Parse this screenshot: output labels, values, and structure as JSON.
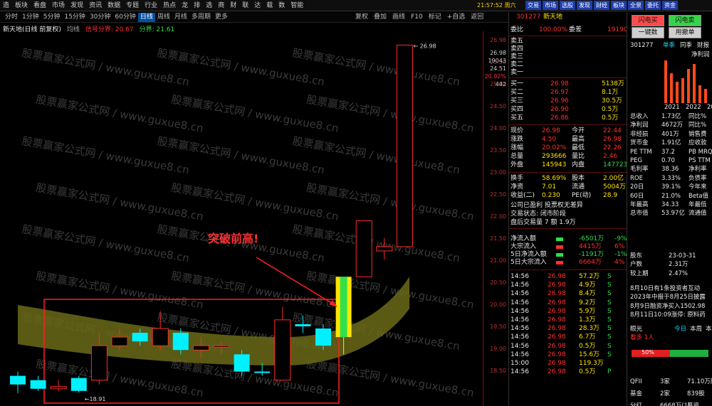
{
  "menu": [
    "造",
    "板块",
    "看盘",
    "市场",
    "发现",
    "资讯",
    "数据",
    "专题",
    "行业",
    "热点",
    "龙",
    "排",
    "选",
    "商",
    "财",
    "联",
    "达",
    "载",
    "数",
    "智能"
  ],
  "clock": "21:57:52 周六",
  "top_buttons": [
    "交易",
    "市场",
    "选股",
    "发现",
    "财经",
    "板块",
    "全景",
    "委托",
    "资金"
  ],
  "periods": [
    "分时",
    "1分钟",
    "5分钟",
    "15分钟",
    "30分钟",
    "60分钟",
    "日线",
    "周线",
    "月线",
    "多周期",
    "更多"
  ],
  "active_period": "日线",
  "tools": [
    "复权",
    "叠加",
    "画线",
    "F10",
    "标记",
    "+自选",
    "返回"
  ],
  "chart_title": {
    "name": "新天地(日线 前复权)",
    "ma": "均线",
    "indicator": "信号分界: 20.67",
    "indicator2": "分界: 21.61"
  },
  "annotation": "突破前高!",
  "watermark": "股票赢家公式网  /  www.guxue8.cn",
  "y_ticks": [
    "26.98",
    "25.50",
    "25.00",
    "24.50",
    "24.00",
    "23.50",
    "23.00",
    "22.50",
    "22.00",
    "21.50",
    "21.00",
    "20.50",
    "20.00",
    "19.50",
    "19.00",
    "18.50"
  ],
  "y_side_values": [
    "26.98",
    "19043",
    "24.51",
    "20.02%",
    "442"
  ],
  "chart_data": {
    "type": "candlestick",
    "last_price": "26.98",
    "low_label": "18.91",
    "candles": [
      {
        "o": 19.1,
        "c": 19.3,
        "h": 19.4,
        "l": 18.9,
        "color": "cyan"
      },
      {
        "o": 19.2,
        "c": 19.0,
        "h": 19.3,
        "l": 18.95,
        "color": "cyan"
      },
      {
        "o": 19.0,
        "c": 19.05,
        "h": 19.2,
        "l": 18.95,
        "color": "red"
      },
      {
        "o": 19.25,
        "c": 18.95,
        "h": 19.3,
        "l": 18.91,
        "color": "cyan"
      },
      {
        "o": 19.2,
        "c": 20.0,
        "h": 20.3,
        "l": 19.1,
        "color": "red"
      },
      {
        "o": 20.0,
        "c": 20.2,
        "h": 20.4,
        "l": 19.9,
        "color": "red"
      },
      {
        "o": 20.3,
        "c": 20.1,
        "h": 20.4,
        "l": 20.0,
        "color": "cyan"
      },
      {
        "o": 20.0,
        "c": 20.4,
        "h": 20.8,
        "l": 19.9,
        "color": "red"
      },
      {
        "o": 20.3,
        "c": 19.9,
        "h": 20.4,
        "l": 19.8,
        "color": "cyan"
      },
      {
        "o": 20.0,
        "c": 19.9,
        "h": 20.2,
        "l": 19.7,
        "color": "red"
      },
      {
        "o": 20.0,
        "c": 20.0,
        "h": 20.1,
        "l": 19.8,
        "color": "red"
      },
      {
        "o": 19.8,
        "c": 19.4,
        "h": 19.9,
        "l": 19.3,
        "color": "cyan"
      },
      {
        "o": 19.4,
        "c": 19.4,
        "h": 19.6,
        "l": 19.3,
        "color": "cyan"
      },
      {
        "o": 19.2,
        "c": 20.6,
        "h": 20.9,
        "l": 19.2,
        "color": "red"
      },
      {
        "o": 20.5,
        "c": 20.45,
        "h": 20.7,
        "l": 20.3,
        "color": "cyan"
      },
      {
        "o": 20.4,
        "c": 20.0,
        "h": 20.5,
        "l": 19.9,
        "color": "cyan"
      },
      {
        "o": 20.2,
        "c": 21.6,
        "h": 21.6,
        "l": 19.8,
        "color": "yellow"
      },
      {
        "o": 21.6,
        "c": 22.9,
        "h": 22.9,
        "l": 21.6,
        "color": "red"
      },
      {
        "o": 22.3,
        "c": 22.2,
        "h": 22.5,
        "l": 22.0,
        "color": "red"
      },
      {
        "o": 22.3,
        "c": 26.98,
        "h": 26.98,
        "l": 22.3,
        "color": "red"
      }
    ]
  },
  "quote": {
    "code": "301277",
    "name": "新天地",
    "weibi_label": "委比",
    "weibi": "100.00%",
    "weicha_label": "委差",
    "weicha": "19190",
    "sell_labels": [
      "卖五",
      "卖四",
      "卖三",
      "卖二",
      "卖一"
    ],
    "buys": [
      {
        "label": "买一",
        "price": "26.98",
        "vol": "5138万"
      },
      {
        "label": "买二",
        "price": "26.97",
        "vol": "8.1万"
      },
      {
        "label": "买三",
        "price": "26.96",
        "vol": "30.5万"
      },
      {
        "label": "买四",
        "price": "26.90",
        "vol": "0.5万"
      },
      {
        "label": "买五",
        "price": "26.86",
        "vol": "0.5万"
      }
    ],
    "stats": [
      {
        "l1": "现价",
        "v1": "26.98",
        "l2": "今开",
        "v2": "22.44"
      },
      {
        "l1": "涨跌",
        "v1": "4.50",
        "l2": "最高",
        "v2": "26.98"
      },
      {
        "l1": "涨幅",
        "v1": "20.02%",
        "l2": "最低",
        "v2": "22.26"
      },
      {
        "l1": "总量",
        "v1": "293666",
        "l2": "量比",
        "v2": "2.46"
      },
      {
        "l1": "外盘",
        "v1": "145943",
        "l2": "内盘",
        "v2": "147723"
      }
    ],
    "stats2": [
      {
        "l1": "换手",
        "v1": "58.69%",
        "l2": "股本",
        "v2": "2.00亿"
      },
      {
        "l1": "净资",
        "v1": "7.01",
        "l2": "流通",
        "v2": "5004万"
      },
      {
        "l1": "收益(二)",
        "v1": "0.230",
        "l2": "PE(动)",
        "v2": "28.9"
      }
    ],
    "notes": [
      "公司已盈利 投票权无差异",
      "交易状态: 闭市阶段",
      "盘后交易量 7 额 1.9万"
    ],
    "flows": [
      {
        "label": "净流入额",
        "value": "-6501万",
        "pct": "-9%"
      },
      {
        "label": "大宗流入",
        "value": "4415万",
        "pct": "6%"
      },
      {
        "label": "5日净流入额",
        "value": "-1191万",
        "pct": "-1%"
      },
      {
        "label": "5日大宗流入",
        "value": "6664万",
        "pct": "4%"
      }
    ],
    "ticks": [
      {
        "t": "14:56",
        "p": "26.98",
        "v": "57.2万",
        "d": "S"
      },
      {
        "t": "14:56",
        "p": "26.98",
        "v": "4.9万",
        "d": "S"
      },
      {
        "t": "14:56",
        "p": "26.98",
        "v": "8.4万",
        "d": "S"
      },
      {
        "t": "14:56",
        "p": "26.98",
        "v": "9.2万",
        "d": "S"
      },
      {
        "t": "14:56",
        "p": "26.98",
        "v": "5.9万",
        "d": "S"
      },
      {
        "t": "14:56",
        "p": "26.98",
        "v": "1.3万",
        "d": "S"
      },
      {
        "t": "14:56",
        "p": "26.98",
        "v": "28.3万",
        "d": "S"
      },
      {
        "t": "14:56",
        "p": "26.98",
        "v": "6.7万",
        "d": "S"
      },
      {
        "t": "14:56",
        "p": "26.98",
        "v": "0.5万",
        "d": "S"
      },
      {
        "t": "14:56",
        "p": "26.98",
        "v": "15.6万",
        "d": "S"
      },
      {
        "t": "15:00",
        "p": "26.98",
        "v": "119.3万",
        "d": ""
      },
      {
        "t": "14:56",
        "p": "26.98",
        "v": "0.5万",
        "d": "P"
      }
    ]
  },
  "rpanel": {
    "buttons": [
      "闪电买",
      "闪电卖",
      "一键数",
      "用撤单",
      "用卖单"
    ],
    "code": "301277",
    "tabs": [
      "单季",
      "同季",
      "财报"
    ],
    "bar_label": "净利润",
    "years": [
      "2021",
      "2022",
      "2023"
    ],
    "bar_values": [
      60,
      42,
      30,
      35,
      48,
      55,
      25,
      20
    ],
    "fin": [
      {
        "l": "总收入",
        "v": "1.73亿",
        "r": "同比%"
      },
      {
        "l": "净利润",
        "v": "4672万",
        "r": "同比%"
      },
      {
        "l": "非经损",
        "v": "401万",
        "r": "销售费"
      },
      {
        "l": "货币金",
        "v": "1.91亿",
        "r": "应收款"
      },
      {
        "l": "PE TTM",
        "v": "37.2",
        "r": "PB MRQ"
      },
      {
        "l": "PEG",
        "v": "0.70",
        "r": "PS TTM"
      },
      {
        "l": "毛利率",
        "v": "38.36",
        "r": "净利率"
      },
      {
        "l": "ROE",
        "v": "3.33%",
        "r": "负债率"
      },
      {
        "l": "20日",
        "v": "39.1%",
        "r": "今年来"
      },
      {
        "l": "60日",
        "v": "21.0%",
        "r": "Beta值"
      },
      {
        "l": "年最高",
        "v": "34.33",
        "r": "年最低"
      },
      {
        "l": "总市值",
        "v": "53.97亿",
        "r": "流通值"
      }
    ],
    "holders": [
      {
        "l": "股东",
        "v": "23-03-31"
      },
      {
        "l": "户数",
        "v": "2.31万"
      },
      {
        "l": "较上期",
        "v": "2.47%"
      }
    ],
    "news": [
      "8月10日有1条投资者互动",
      "2023年中报于8月25日披露",
      "8月9日融资净买入1502.98",
      "8月11日10:09涨停: 原料药"
    ],
    "eyes": {
      "label": "眼光",
      "tabs": [
        "今日",
        "本周",
        "本月"
      ],
      "row": "看多 1人"
    },
    "vote_pct": "50%",
    "bottom": [
      {
        "l": "QFII",
        "v": "3家",
        "r": "71.10万股"
      },
      {
        "l": "基金",
        "v": "2家",
        "r": "839股"
      },
      {
        "l": "分红",
        "v": "6668万(1)",
        "r": "募资"
      }
    ]
  }
}
